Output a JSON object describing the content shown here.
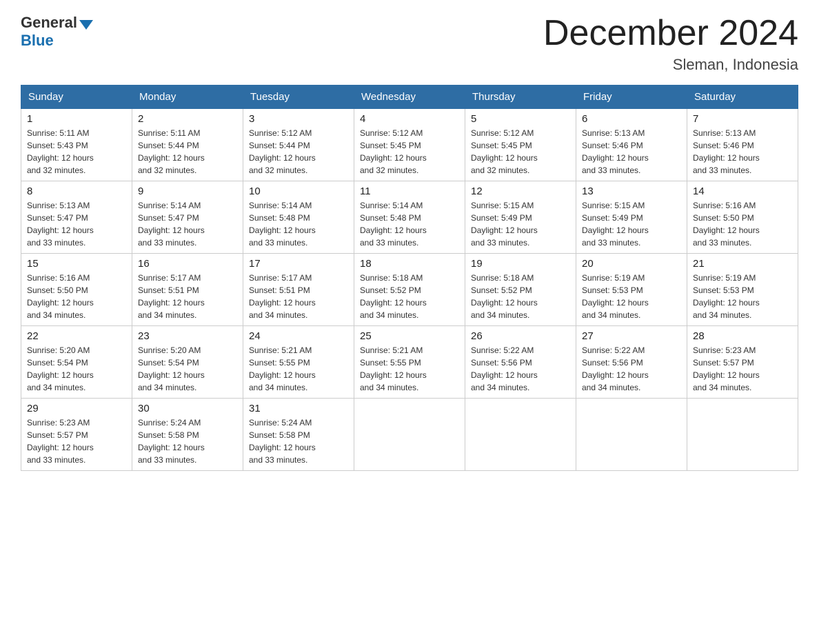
{
  "logo": {
    "general": "General",
    "blue": "Blue"
  },
  "title": {
    "month": "December 2024",
    "location": "Sleman, Indonesia"
  },
  "days_header": [
    "Sunday",
    "Monday",
    "Tuesday",
    "Wednesday",
    "Thursday",
    "Friday",
    "Saturday"
  ],
  "weeks": [
    [
      {
        "day": "1",
        "sunrise": "5:11 AM",
        "sunset": "5:43 PM",
        "daylight": "12 hours and 32 minutes."
      },
      {
        "day": "2",
        "sunrise": "5:11 AM",
        "sunset": "5:44 PM",
        "daylight": "12 hours and 32 minutes."
      },
      {
        "day": "3",
        "sunrise": "5:12 AM",
        "sunset": "5:44 PM",
        "daylight": "12 hours and 32 minutes."
      },
      {
        "day": "4",
        "sunrise": "5:12 AM",
        "sunset": "5:45 PM",
        "daylight": "12 hours and 32 minutes."
      },
      {
        "day": "5",
        "sunrise": "5:12 AM",
        "sunset": "5:45 PM",
        "daylight": "12 hours and 32 minutes."
      },
      {
        "day": "6",
        "sunrise": "5:13 AM",
        "sunset": "5:46 PM",
        "daylight": "12 hours and 33 minutes."
      },
      {
        "day": "7",
        "sunrise": "5:13 AM",
        "sunset": "5:46 PM",
        "daylight": "12 hours and 33 minutes."
      }
    ],
    [
      {
        "day": "8",
        "sunrise": "5:13 AM",
        "sunset": "5:47 PM",
        "daylight": "12 hours and 33 minutes."
      },
      {
        "day": "9",
        "sunrise": "5:14 AM",
        "sunset": "5:47 PM",
        "daylight": "12 hours and 33 minutes."
      },
      {
        "day": "10",
        "sunrise": "5:14 AM",
        "sunset": "5:48 PM",
        "daylight": "12 hours and 33 minutes."
      },
      {
        "day": "11",
        "sunrise": "5:14 AM",
        "sunset": "5:48 PM",
        "daylight": "12 hours and 33 minutes."
      },
      {
        "day": "12",
        "sunrise": "5:15 AM",
        "sunset": "5:49 PM",
        "daylight": "12 hours and 33 minutes."
      },
      {
        "day": "13",
        "sunrise": "5:15 AM",
        "sunset": "5:49 PM",
        "daylight": "12 hours and 33 minutes."
      },
      {
        "day": "14",
        "sunrise": "5:16 AM",
        "sunset": "5:50 PM",
        "daylight": "12 hours and 33 minutes."
      }
    ],
    [
      {
        "day": "15",
        "sunrise": "5:16 AM",
        "sunset": "5:50 PM",
        "daylight": "12 hours and 34 minutes."
      },
      {
        "day": "16",
        "sunrise": "5:17 AM",
        "sunset": "5:51 PM",
        "daylight": "12 hours and 34 minutes."
      },
      {
        "day": "17",
        "sunrise": "5:17 AM",
        "sunset": "5:51 PM",
        "daylight": "12 hours and 34 minutes."
      },
      {
        "day": "18",
        "sunrise": "5:18 AM",
        "sunset": "5:52 PM",
        "daylight": "12 hours and 34 minutes."
      },
      {
        "day": "19",
        "sunrise": "5:18 AM",
        "sunset": "5:52 PM",
        "daylight": "12 hours and 34 minutes."
      },
      {
        "day": "20",
        "sunrise": "5:19 AM",
        "sunset": "5:53 PM",
        "daylight": "12 hours and 34 minutes."
      },
      {
        "day": "21",
        "sunrise": "5:19 AM",
        "sunset": "5:53 PM",
        "daylight": "12 hours and 34 minutes."
      }
    ],
    [
      {
        "day": "22",
        "sunrise": "5:20 AM",
        "sunset": "5:54 PM",
        "daylight": "12 hours and 34 minutes."
      },
      {
        "day": "23",
        "sunrise": "5:20 AM",
        "sunset": "5:54 PM",
        "daylight": "12 hours and 34 minutes."
      },
      {
        "day": "24",
        "sunrise": "5:21 AM",
        "sunset": "5:55 PM",
        "daylight": "12 hours and 34 minutes."
      },
      {
        "day": "25",
        "sunrise": "5:21 AM",
        "sunset": "5:55 PM",
        "daylight": "12 hours and 34 minutes."
      },
      {
        "day": "26",
        "sunrise": "5:22 AM",
        "sunset": "5:56 PM",
        "daylight": "12 hours and 34 minutes."
      },
      {
        "day": "27",
        "sunrise": "5:22 AM",
        "sunset": "5:56 PM",
        "daylight": "12 hours and 34 minutes."
      },
      {
        "day": "28",
        "sunrise": "5:23 AM",
        "sunset": "5:57 PM",
        "daylight": "12 hours and 34 minutes."
      }
    ],
    [
      {
        "day": "29",
        "sunrise": "5:23 AM",
        "sunset": "5:57 PM",
        "daylight": "12 hours and 33 minutes."
      },
      {
        "day": "30",
        "sunrise": "5:24 AM",
        "sunset": "5:58 PM",
        "daylight": "12 hours and 33 minutes."
      },
      {
        "day": "31",
        "sunrise": "5:24 AM",
        "sunset": "5:58 PM",
        "daylight": "12 hours and 33 minutes."
      },
      null,
      null,
      null,
      null
    ]
  ],
  "labels": {
    "sunrise": "Sunrise:",
    "sunset": "Sunset:",
    "daylight": "Daylight:"
  }
}
